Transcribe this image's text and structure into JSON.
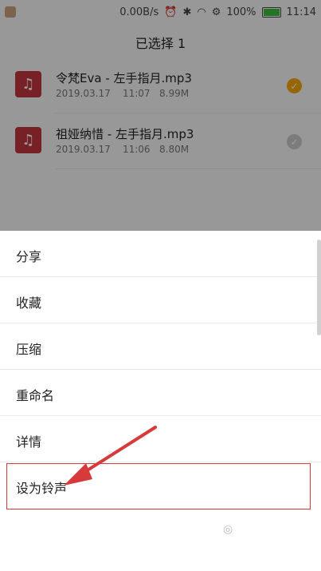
{
  "status_bar": {
    "speed": "0.00B/s",
    "battery_pct": "100%",
    "time": "11:14"
  },
  "header": {
    "title": "已选择 1"
  },
  "files": [
    {
      "name": "令梵Eva - 左手指月.mp3",
      "date": "2019.03.17",
      "time": "11:07",
      "size": "8.99M",
      "selected": true
    },
    {
      "name": "祖娅纳惜 - 左手指月.mp3",
      "date": "2019.03.17",
      "time": "11:06",
      "size": "8.80M",
      "selected": false
    }
  ],
  "menu": {
    "items": [
      {
        "label": "分享"
      },
      {
        "label": "收藏"
      },
      {
        "label": "压缩"
      },
      {
        "label": "重命名"
      },
      {
        "label": "详情"
      },
      {
        "label": "设为铃声"
      }
    ]
  },
  "icons": {
    "music": "music-note-icon",
    "check": "check-circle-icon",
    "battery": "battery-icon"
  },
  "colors": {
    "accent": "#f2a600",
    "highlight": "#d63a3a",
    "file_icon_bg": "#c0343d"
  }
}
